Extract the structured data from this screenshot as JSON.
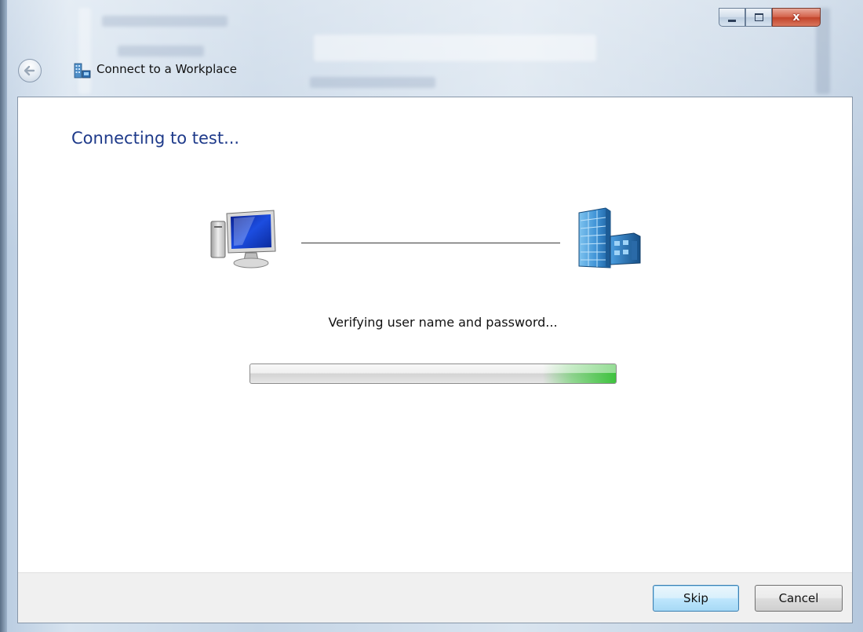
{
  "window": {
    "title": "Connect to a Workplace",
    "caption_buttons": {
      "minimize_icon": "minimize-icon",
      "maximize_icon": "maximize-icon",
      "close_label": "x"
    }
  },
  "wizard": {
    "heading": "Connecting to test...",
    "status_text": "Verifying user name and password...",
    "progress_state": "marquee-indeterminate",
    "progress_color": "#3ec23e",
    "heading_color": "#1e3a8a"
  },
  "icons": {
    "back": "back-arrow-icon",
    "app": "workplace-connection-icon",
    "source": "computer-icon",
    "destination": "office-building-icon"
  },
  "footer": {
    "skip_label": "Skip",
    "cancel_label": "Cancel"
  }
}
